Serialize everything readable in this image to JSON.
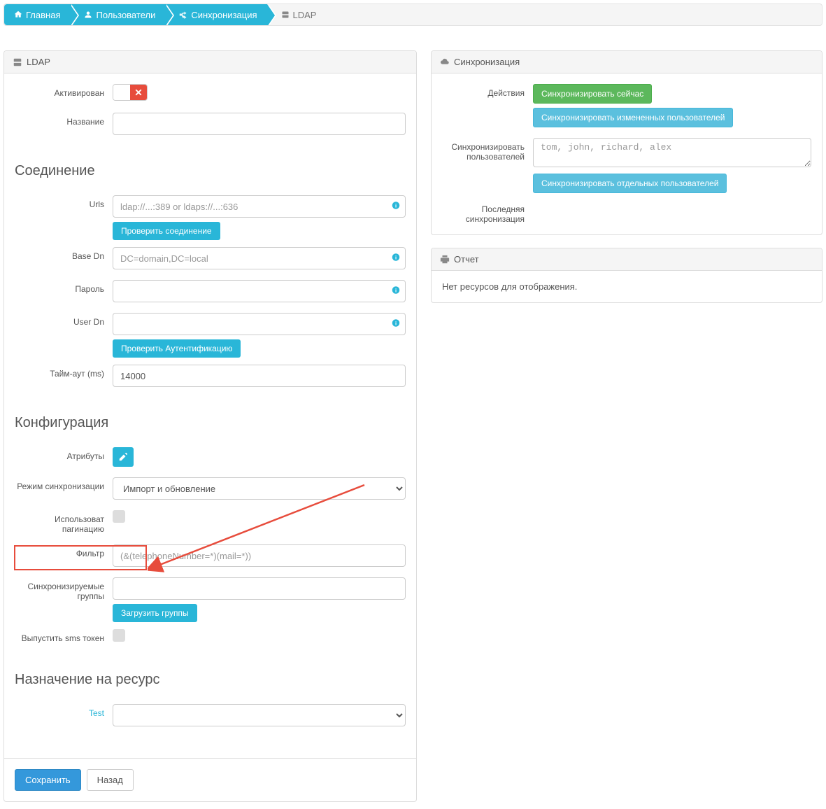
{
  "breadcrumbs": {
    "home": "Главная",
    "users": "Пользователи",
    "sync": "Синхронизация",
    "ldap": "LDAP"
  },
  "ldap_panel": {
    "title": "LDAP",
    "activated_label": "Активирован",
    "name_label": "Название"
  },
  "connection": {
    "heading": "Соединение",
    "urls_label": "Urls",
    "urls_placeholder": "ldap://...:389 or ldaps://...:636",
    "check_conn_btn": "Проверить соединение",
    "base_dn_label": "Base Dn",
    "base_dn_placeholder": "DC=domain,DC=local",
    "password_label": "Пароль",
    "user_dn_label": "User Dn",
    "check_auth_btn": "Проверить Аутентификацию",
    "timeout_label": "Тайм-аут (ms)",
    "timeout_value": "14000"
  },
  "config": {
    "heading": "Конфигурация",
    "attributes_label": "Атрибуты",
    "sync_mode_label": "Режим синхронизации",
    "sync_mode_value": "Импорт и обновление",
    "use_pagination_label": "Использоват пагинацию",
    "filter_label": "Фильтр",
    "filter_placeholder": "(&(telephoneNumber=*)(mail=*))",
    "sync_groups_label": "Синхронизируемые группы",
    "load_groups_btn": "Загрузить группы",
    "issue_sms_label": "Выпустить sms токен"
  },
  "resource": {
    "heading": "Назначение на ресурс",
    "test_label": "Test"
  },
  "footer": {
    "save": "Сохранить",
    "back": "Назад"
  },
  "sync_panel": {
    "title": "Синхронизация",
    "actions_label": "Действия",
    "sync_now_btn": "Синхронизировать сейчас",
    "sync_changed_btn": "Синхронизировать измененных пользователей",
    "sync_users_label": "Синхронизировать пользователей",
    "sync_users_placeholder": "tom, john, richard, alex",
    "sync_selected_btn": "Синхронизировать отдельных пользователей",
    "last_sync_label": "Последняя синхронизация"
  },
  "report_panel": {
    "title": "Отчет",
    "no_resources": "Нет ресурсов для отображения."
  }
}
